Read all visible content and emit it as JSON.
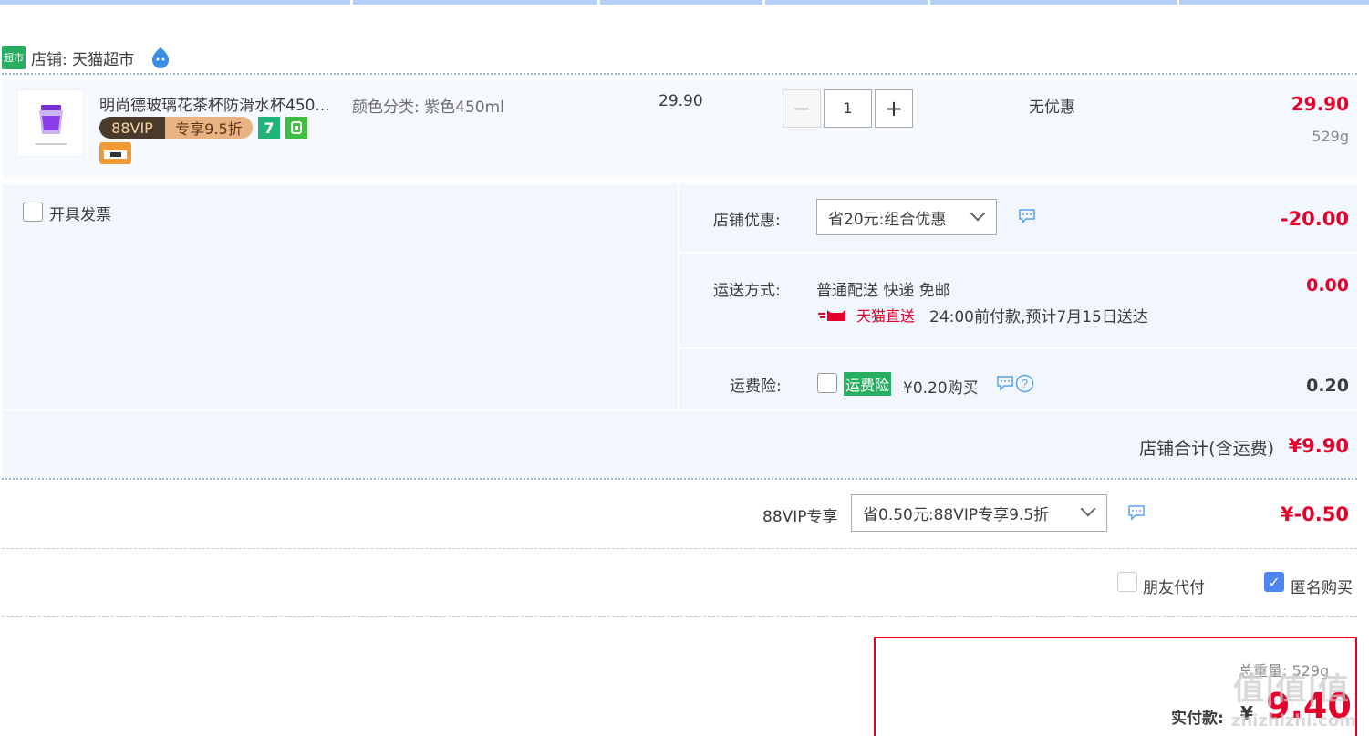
{
  "shop": {
    "badge": "超市",
    "label": "店铺: 天猫超市"
  },
  "item": {
    "title": "明尚德玻璃花茶杯防滑水杯450...",
    "vip_tag_left": "88VIP",
    "vip_tag_right": "专享9.5折",
    "badge_7": "7",
    "sku": "颜色分类: 紫色450ml",
    "price": "29.90",
    "quantity": "1",
    "promo": "无优惠",
    "subtotal": "29.90",
    "weight": "529g"
  },
  "invoice": {
    "label": "开具发票"
  },
  "shop_promo": {
    "label": "店铺优惠:",
    "selected": "省20元:组合优惠",
    "amount": "-20.00"
  },
  "shipping": {
    "label": "运送方式:",
    "method": "普通配送 快递 免邮",
    "express_tag": "天猫直送",
    "eta": "24:00前付款,预计7月15日送达",
    "amount": "0.00"
  },
  "insurance": {
    "label": "运费险:",
    "tag": "运费险",
    "price": "¥0.20购买",
    "amount": "0.20"
  },
  "shop_total": {
    "label": "店铺合计(含运费)",
    "amount": "¥9.90"
  },
  "vip": {
    "label": "88VIP专享",
    "selected": "省0.50元:88VIP专享9.5折",
    "amount": "¥-0.50"
  },
  "options": {
    "friend_pay": "朋友代付",
    "anonymous": "匿名购买"
  },
  "pay": {
    "weight_label": "总重量: 529g",
    "actual_label": "实付款:",
    "currency": "¥",
    "actual_amount": "9.40"
  },
  "watermark": {
    "logo": "值|值|值",
    "site": "zhizhizhi.com"
  },
  "colors": {
    "accent_red": "#e4002b",
    "panel_bg": "#f2f7fe",
    "tmall_green": "#27ae60",
    "checkbox_blue": "#4d86f0"
  }
}
